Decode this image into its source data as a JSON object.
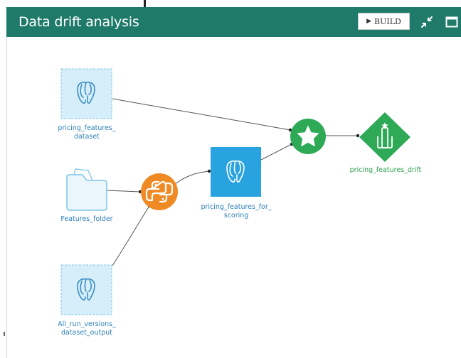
{
  "header": {
    "title": "Data drift analysis",
    "build_label": "BUILD",
    "background_color": "#1f7a6a",
    "icons": [
      "collapse-icon",
      "maximize-icon"
    ]
  },
  "flow": {
    "nodes": [
      {
        "id": "pricing_features_dataset",
        "kind": "dataset",
        "label_line1": "pricing_features_",
        "label_line2": "dataset",
        "icon": "postgresql-icon"
      },
      {
        "id": "features_folder",
        "kind": "folder",
        "label": "Features_folder",
        "icon": "folder-icon"
      },
      {
        "id": "all_run_versions",
        "kind": "dataset",
        "label_line1": "All_run_versions_",
        "label_line2": "dataset_output",
        "icon": "postgresql-icon"
      },
      {
        "id": "python_recipe",
        "kind": "recipe",
        "icon": "python-icon",
        "color": "#f08a24"
      },
      {
        "id": "pricing_features_for_scoring",
        "kind": "dataset",
        "label_line1": "pricing_features_for_",
        "label_line2": "scoring",
        "icon": "postgresql-icon",
        "color": "#29a3e0"
      },
      {
        "id": "evaluate_recipe",
        "kind": "recipe",
        "icon": "star-icon",
        "color": "#2eaa57"
      },
      {
        "id": "pricing_features_drift",
        "kind": "model-evaluation-store",
        "label": "pricing_features_drift",
        "icon": "evaluation-store-icon",
        "color": "#2eaa57"
      }
    ]
  },
  "colors": {
    "dataset_fill": "#d6eef9",
    "dataset_border": "#7cc4ea",
    "label_blue": "#2d7fb8",
    "label_green": "#2e9e4f"
  }
}
